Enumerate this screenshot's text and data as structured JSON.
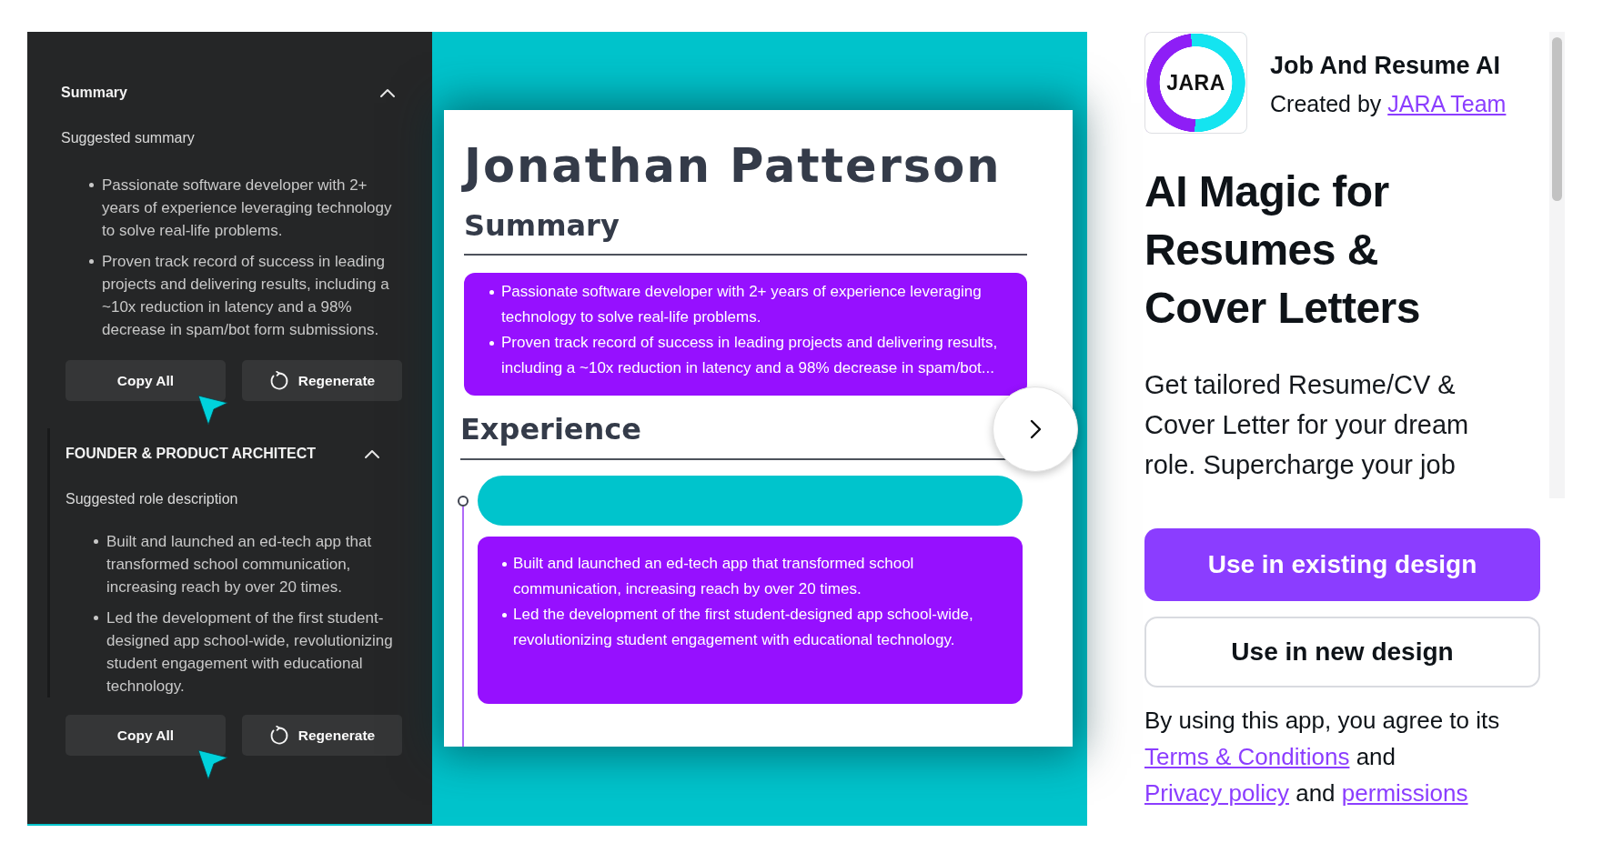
{
  "editor_panel": {
    "sections": [
      {
        "heading": "Summary",
        "expanded": true,
        "subheading": "Suggested summary",
        "bullets": [
          "Passionate software developer with 2+ years of experience leveraging technology to solve real-life problems.",
          "Proven track record of success in leading projects and delivering results, including a ~10x reduction in latency and a 98% decrease in spam/bot form submissions."
        ],
        "buttons": [
          {
            "label": "Copy All",
            "kind": "copy"
          },
          {
            "label": "Regenerate",
            "kind": "regenerate"
          }
        ]
      },
      {
        "heading": "FOUNDER & PRODUCT ARCHITECT",
        "expanded": true,
        "subheading": "Suggested role description",
        "bullets": [
          "Built and launched an ed-tech app that transformed school communication, increasing reach by over 20 times.",
          "Led the development of the first student-designed app school-wide, revolutionizing student engagement with educational technology."
        ],
        "buttons": [
          {
            "label": "Copy All",
            "kind": "copy"
          },
          {
            "label": "Regenerate",
            "kind": "regenerate"
          }
        ]
      }
    ]
  },
  "resume_preview": {
    "name": "Jonathan Patterson",
    "sections": [
      {
        "kind": "summary",
        "heading": "Summary",
        "bullets": [
          "Passionate software developer with 2+ years of experience leveraging technology to solve real-life problems.",
          "Proven track record of success in leading projects and delivering results, including a ~10x reduction in latency and a 98% decrease in spam/bot..."
        ]
      },
      {
        "kind": "timeline",
        "heading": "Experience",
        "entries": [
          {
            "bullets": [
              "Built and launched an ed-tech app that transformed school communication, increasing reach by over 20 times.",
              "Led the development of the first student-designed app school-wide, revolutionizing student engagement with educational technology."
            ]
          }
        ]
      }
    ]
  },
  "app_listing": {
    "logo_text": "JARA",
    "name": "Job And Resume AI",
    "creator_label": "Created by",
    "creator_name": "JARA Team",
    "headline": "AI Magic for Resumes & Cover Letters",
    "description": "Get tailored Resume/CV & Cover Letter for your dream role. Supercharge your job",
    "actions": [
      {
        "label": "Use in existing design",
        "kind": "primary"
      },
      {
        "label": "Use in new design",
        "kind": "secondary"
      }
    ],
    "terms": [
      {
        "kind": "text",
        "text": "By using this app, you agree to its"
      },
      {
        "kind": "link",
        "text": "Terms & Conditions"
      },
      {
        "kind": "text",
        "text": "and"
      },
      {
        "kind": "link",
        "text": "Privacy policy"
      },
      {
        "kind": "text",
        "text": "and"
      },
      {
        "kind": "link",
        "text": "permissions"
      }
    ]
  }
}
